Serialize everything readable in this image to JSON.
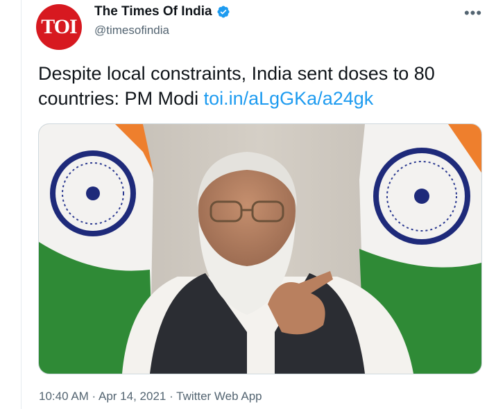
{
  "account": {
    "avatar_text": "TOI",
    "display_name": "The Times Of India",
    "handle": "@timesofindia"
  },
  "tweet": {
    "text": "Despite local constraints, India sent doses to 80 countries: PM Modi ",
    "link": "toi.in/aLgGKa/a24gk"
  },
  "meta": {
    "timestamp": "10:40 AM · Apr 14, 2021 · Twitter Web App"
  },
  "icons": {
    "verified": "verified-badge-icon",
    "more": "more-options-icon"
  },
  "colors": {
    "avatar_red": "#d71920",
    "link_blue": "#1d9bf0",
    "muted_gray": "#536471"
  }
}
